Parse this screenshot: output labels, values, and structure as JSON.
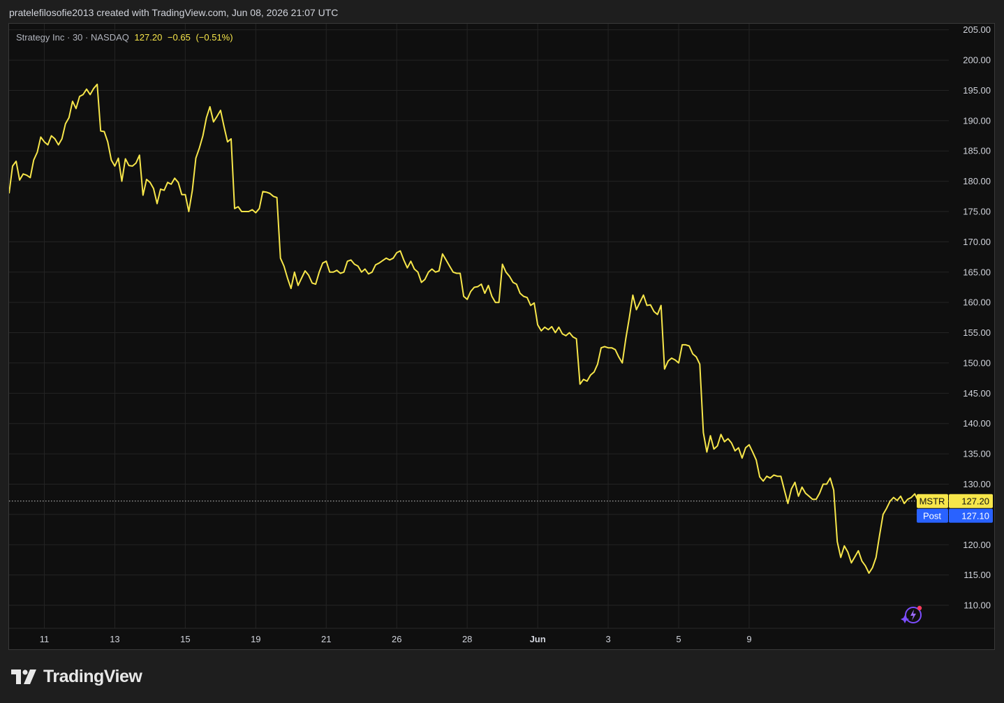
{
  "attribution": "pratelefilosofie2013 created with TradingView.com, Jun 08, 2026 21:07 UTC",
  "legend": {
    "name": "Strategy Inc",
    "interval": "30",
    "exchange": "NASDAQ",
    "last": "127.20",
    "change": "−0.65",
    "change_pct": "(−0.51%)"
  },
  "branding": {
    "logo_text": "TradingView"
  },
  "icons": {
    "logo": "tradingview-logo-icon",
    "assistant": "sparkle-assistant-icon"
  },
  "colors": {
    "background": "#0f0f0f",
    "frame": "#1e1e1e",
    "line": "#f7e64a",
    "grid": "#242424",
    "axis_text": "#d1d4dc",
    "price_tag": "#f7e64a",
    "post_tag": "#2962ff"
  },
  "chart_data": {
    "type": "line",
    "title": "",
    "xlabel": "",
    "ylabel": "",
    "series": [
      {
        "name": "MSTR",
        "values": [
          [
            0.0,
            178.0
          ],
          [
            0.15,
            182.5
          ],
          [
            0.3,
            183.3
          ],
          [
            0.45,
            180.2
          ],
          [
            0.6,
            181.2
          ],
          [
            0.75,
            181.0
          ],
          [
            0.9,
            180.6
          ],
          [
            1.05,
            183.5
          ],
          [
            1.2,
            184.8
          ],
          [
            1.35,
            187.3
          ],
          [
            1.5,
            186.5
          ],
          [
            1.65,
            186.0
          ],
          [
            1.8,
            187.5
          ],
          [
            1.95,
            187.0
          ],
          [
            2.1,
            186.0
          ],
          [
            2.25,
            187.0
          ],
          [
            2.4,
            189.5
          ],
          [
            2.55,
            190.5
          ],
          [
            2.7,
            193.2
          ],
          [
            2.85,
            192.0
          ],
          [
            3.0,
            194.0
          ],
          [
            3.15,
            194.3
          ],
          [
            3.3,
            195.2
          ],
          [
            3.45,
            194.3
          ],
          [
            3.6,
            195.3
          ],
          [
            3.75,
            196.0
          ],
          [
            3.9,
            188.3
          ],
          [
            4.05,
            188.2
          ],
          [
            4.2,
            186.5
          ],
          [
            4.35,
            183.5
          ],
          [
            4.5,
            182.5
          ],
          [
            4.65,
            183.8
          ],
          [
            4.8,
            180.0
          ],
          [
            4.95,
            183.7
          ],
          [
            5.1,
            182.6
          ],
          [
            5.25,
            182.5
          ],
          [
            5.4,
            183.0
          ],
          [
            5.55,
            184.3
          ],
          [
            5.7,
            177.7
          ],
          [
            5.85,
            180.3
          ],
          [
            6.0,
            179.8
          ],
          [
            6.15,
            178.8
          ],
          [
            6.3,
            176.3
          ],
          [
            6.45,
            178.7
          ],
          [
            6.6,
            178.5
          ],
          [
            6.75,
            179.8
          ],
          [
            6.9,
            179.5
          ],
          [
            7.05,
            180.5
          ],
          [
            7.2,
            179.8
          ],
          [
            7.35,
            177.8
          ],
          [
            7.5,
            177.8
          ],
          [
            7.65,
            175.0
          ],
          [
            7.8,
            178.5
          ],
          [
            7.95,
            183.8
          ],
          [
            8.1,
            185.5
          ],
          [
            8.25,
            187.5
          ],
          [
            8.4,
            190.5
          ],
          [
            8.55,
            192.3
          ],
          [
            8.7,
            189.8
          ],
          [
            8.85,
            190.7
          ],
          [
            9.0,
            191.7
          ],
          [
            9.15,
            189.0
          ],
          [
            9.3,
            186.5
          ],
          [
            9.45,
            187.0
          ],
          [
            9.6,
            175.5
          ],
          [
            9.75,
            175.8
          ],
          [
            9.9,
            175.0
          ],
          [
            10.05,
            175.0
          ],
          [
            10.2,
            175.0
          ],
          [
            10.35,
            175.3
          ],
          [
            10.5,
            174.8
          ],
          [
            10.65,
            175.5
          ],
          [
            10.8,
            178.3
          ],
          [
            10.95,
            178.2
          ],
          [
            11.1,
            178.0
          ],
          [
            11.25,
            177.5
          ],
          [
            11.4,
            177.3
          ],
          [
            11.55,
            167.3
          ],
          [
            11.7,
            166.0
          ],
          [
            11.85,
            164.0
          ],
          [
            12.0,
            162.3
          ],
          [
            12.15,
            165.0
          ],
          [
            12.3,
            162.8
          ],
          [
            12.45,
            164.0
          ],
          [
            12.6,
            165.2
          ],
          [
            12.75,
            164.5
          ],
          [
            12.9,
            163.2
          ],
          [
            13.05,
            163.0
          ],
          [
            13.2,
            165.0
          ],
          [
            13.35,
            166.5
          ],
          [
            13.5,
            166.8
          ],
          [
            13.65,
            165.0
          ],
          [
            13.8,
            165.0
          ],
          [
            13.95,
            165.3
          ],
          [
            14.1,
            164.8
          ],
          [
            14.25,
            165.0
          ],
          [
            14.4,
            166.8
          ],
          [
            14.55,
            167.0
          ],
          [
            14.7,
            166.3
          ],
          [
            14.85,
            166.0
          ],
          [
            15.0,
            165.0
          ],
          [
            15.15,
            165.5
          ],
          [
            15.3,
            164.7
          ],
          [
            15.45,
            165.0
          ],
          [
            15.6,
            166.2
          ],
          [
            15.75,
            166.5
          ],
          [
            15.9,
            166.9
          ],
          [
            16.05,
            167.3
          ],
          [
            16.2,
            167.0
          ],
          [
            16.35,
            167.3
          ],
          [
            16.5,
            168.2
          ],
          [
            16.65,
            168.5
          ],
          [
            16.8,
            167.0
          ],
          [
            16.95,
            165.7
          ],
          [
            17.1,
            166.8
          ],
          [
            17.25,
            165.5
          ],
          [
            17.4,
            165.0
          ],
          [
            17.55,
            163.3
          ],
          [
            17.7,
            163.8
          ],
          [
            17.85,
            165.0
          ],
          [
            18.0,
            165.5
          ],
          [
            18.15,
            165.0
          ],
          [
            18.3,
            165.2
          ],
          [
            18.45,
            168.0
          ],
          [
            18.6,
            167.0
          ],
          [
            18.75,
            166.0
          ],
          [
            18.9,
            165.0
          ],
          [
            19.05,
            164.8
          ],
          [
            19.2,
            164.8
          ],
          [
            19.35,
            161.0
          ],
          [
            19.5,
            160.5
          ],
          [
            19.65,
            161.8
          ],
          [
            19.8,
            162.5
          ],
          [
            19.95,
            162.6
          ],
          [
            20.1,
            163.0
          ],
          [
            20.25,
            161.5
          ],
          [
            20.4,
            162.8
          ],
          [
            20.55,
            161.0
          ],
          [
            20.7,
            160.0
          ],
          [
            20.85,
            160.0
          ],
          [
            21.0,
            166.3
          ],
          [
            21.15,
            165.0
          ],
          [
            21.3,
            164.3
          ],
          [
            21.45,
            163.3
          ],
          [
            21.6,
            163.0
          ],
          [
            21.75,
            161.5
          ],
          [
            21.9,
            161.0
          ],
          [
            22.05,
            160.8
          ],
          [
            22.2,
            159.5
          ],
          [
            22.35,
            159.9
          ],
          [
            22.5,
            156.3
          ],
          [
            22.65,
            155.3
          ],
          [
            22.8,
            155.9
          ],
          [
            22.95,
            155.5
          ],
          [
            23.1,
            156.0
          ],
          [
            23.25,
            155.0
          ],
          [
            23.4,
            155.9
          ],
          [
            23.55,
            154.8
          ],
          [
            23.7,
            154.5
          ],
          [
            23.85,
            155.0
          ],
          [
            24.0,
            154.3
          ],
          [
            24.15,
            154.0
          ],
          [
            24.3,
            146.5
          ],
          [
            24.45,
            147.3
          ],
          [
            24.6,
            147.0
          ],
          [
            24.75,
            148.0
          ],
          [
            24.9,
            148.5
          ],
          [
            25.05,
            149.8
          ],
          [
            25.2,
            152.5
          ],
          [
            25.35,
            152.7
          ],
          [
            25.5,
            152.5
          ],
          [
            25.65,
            152.5
          ],
          [
            25.8,
            152.2
          ],
          [
            25.95,
            151.0
          ],
          [
            26.1,
            150.0
          ],
          [
            26.25,
            154.0
          ],
          [
            26.4,
            157.5
          ],
          [
            26.55,
            161.2
          ],
          [
            26.7,
            158.8
          ],
          [
            26.85,
            160.0
          ],
          [
            27.0,
            161.2
          ],
          [
            27.15,
            159.5
          ],
          [
            27.3,
            159.6
          ],
          [
            27.45,
            158.5
          ],
          [
            27.6,
            158.0
          ],
          [
            27.75,
            159.5
          ],
          [
            27.9,
            149.0
          ],
          [
            28.05,
            150.3
          ],
          [
            28.2,
            150.8
          ],
          [
            28.35,
            150.5
          ],
          [
            28.5,
            150.0
          ],
          [
            28.65,
            153.0
          ],
          [
            28.8,
            153.0
          ],
          [
            28.95,
            152.8
          ],
          [
            29.1,
            151.5
          ],
          [
            29.25,
            151.0
          ],
          [
            29.4,
            149.8
          ],
          [
            29.55,
            138.5
          ],
          [
            29.7,
            135.3
          ],
          [
            29.85,
            138.0
          ],
          [
            30.0,
            135.8
          ],
          [
            30.15,
            136.3
          ],
          [
            30.3,
            138.2
          ],
          [
            30.45,
            137.0
          ],
          [
            30.6,
            137.5
          ],
          [
            30.75,
            136.8
          ],
          [
            30.9,
            135.5
          ],
          [
            31.05,
            136.0
          ],
          [
            31.2,
            134.3
          ],
          [
            31.35,
            136.0
          ],
          [
            31.5,
            136.5
          ],
          [
            31.65,
            135.3
          ],
          [
            31.8,
            134.0
          ],
          [
            31.95,
            131.2
          ],
          [
            32.1,
            130.5
          ],
          [
            32.25,
            131.3
          ],
          [
            32.4,
            131.0
          ],
          [
            32.55,
            131.5
          ],
          [
            32.7,
            131.3
          ],
          [
            32.85,
            131.3
          ],
          [
            33.0,
            129.0
          ],
          [
            33.15,
            126.8
          ],
          [
            33.3,
            129.2
          ],
          [
            33.45,
            130.3
          ],
          [
            33.6,
            128.0
          ],
          [
            33.75,
            129.5
          ],
          [
            33.9,
            128.5
          ],
          [
            34.05,
            128.0
          ],
          [
            34.2,
            127.5
          ],
          [
            34.35,
            127.5
          ],
          [
            34.5,
            128.5
          ],
          [
            34.65,
            130.0
          ],
          [
            34.8,
            130.0
          ],
          [
            34.95,
            131.0
          ],
          [
            35.1,
            129.0
          ],
          [
            35.25,
            120.5
          ],
          [
            35.4,
            117.9
          ],
          [
            35.55,
            119.8
          ],
          [
            35.7,
            118.8
          ],
          [
            35.85,
            117.0
          ],
          [
            36.0,
            118.0
          ],
          [
            36.15,
            119.0
          ],
          [
            36.3,
            117.3
          ],
          [
            36.45,
            116.5
          ],
          [
            36.6,
            115.3
          ],
          [
            36.75,
            116.2
          ],
          [
            36.9,
            117.9
          ],
          [
            37.05,
            121.5
          ],
          [
            37.2,
            125.0
          ],
          [
            37.35,
            126.0
          ],
          [
            37.5,
            127.2
          ],
          [
            37.65,
            127.8
          ],
          [
            37.8,
            127.3
          ],
          [
            37.95,
            128.0
          ],
          [
            38.1,
            126.8
          ],
          [
            38.25,
            127.5
          ],
          [
            38.4,
            127.8
          ],
          [
            38.55,
            128.4
          ],
          [
            38.7,
            127.2
          ],
          [
            38.85,
            127.7
          ],
          [
            39.0,
            127.2
          ]
        ]
      }
    ],
    "ylim": [
      106.2,
      206.0
    ],
    "y_ticks": [
      "205.00",
      "200.00",
      "195.00",
      "190.00",
      "185.00",
      "180.00",
      "175.00",
      "170.00",
      "165.00",
      "160.00",
      "155.00",
      "150.00",
      "145.00",
      "140.00",
      "135.00",
      "130.00",
      "125.00",
      "120.00",
      "115.00",
      "110.00"
    ],
    "x_ticks": [
      {
        "label": "11",
        "x": 1.5,
        "bold": false
      },
      {
        "label": "13",
        "x": 4.5,
        "bold": false
      },
      {
        "label": "15",
        "x": 7.5,
        "bold": false
      },
      {
        "label": "19",
        "x": 10.5,
        "bold": false
      },
      {
        "label": "21",
        "x": 13.5,
        "bold": false
      },
      {
        "label": "26",
        "x": 16.5,
        "bold": false
      },
      {
        "label": "28",
        "x": 19.5,
        "bold": false
      },
      {
        "label": "Jun",
        "x": 22.5,
        "bold": true
      },
      {
        "label": "3",
        "x": 25.5,
        "bold": false
      },
      {
        "label": "5",
        "x": 28.5,
        "bold": false
      },
      {
        "label": "9",
        "x": 31.5,
        "bold": false
      }
    ],
    "xlim": [
      0,
      40
    ],
    "grid": true,
    "price_line": 127.2,
    "price_tags": [
      {
        "label": "MSTR",
        "value": "127.20",
        "kind": "last"
      },
      {
        "label": "Post",
        "value": "127.10",
        "kind": "post"
      }
    ]
  }
}
